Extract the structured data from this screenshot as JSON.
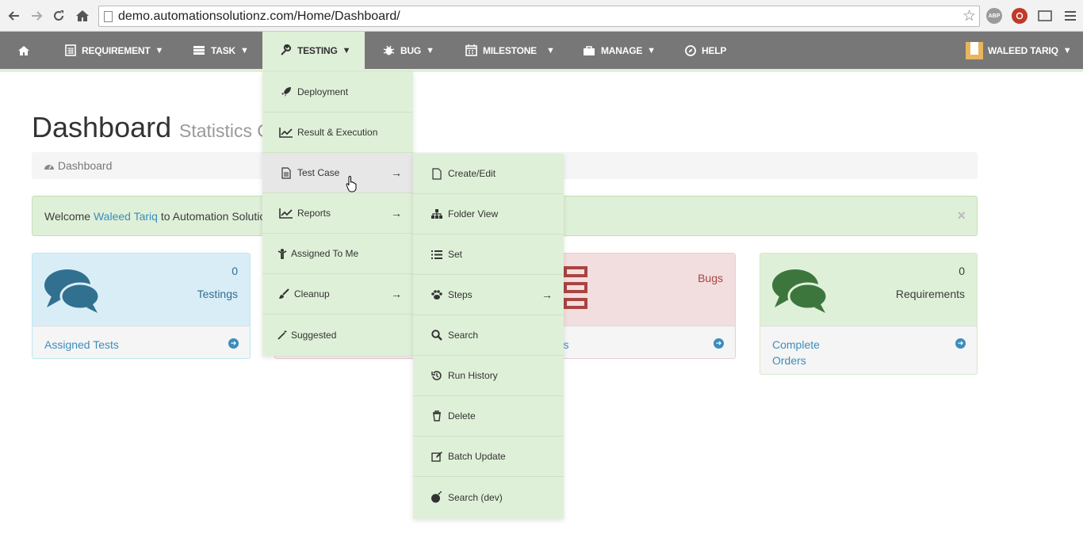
{
  "browser": {
    "url": "demo.automationsolutionz.com/Home/Dashboard/",
    "extensions": [
      "ABP"
    ]
  },
  "navbar": {
    "items": [
      {
        "label": "REQUIREMENT",
        "icon": "calculator-icon"
      },
      {
        "label": "TASK",
        "icon": "tasks-icon"
      },
      {
        "label": "TESTING",
        "icon": "wrench-icon",
        "active": true
      },
      {
        "label": "BUG",
        "icon": "bug-icon"
      },
      {
        "label": "MILESTONE",
        "icon": "calendar-icon"
      },
      {
        "label": "MANAGE",
        "icon": "briefcase-icon"
      },
      {
        "label": "HELP",
        "icon": "compass-icon"
      }
    ],
    "caret": "▼",
    "user": "WALEED TARIQ"
  },
  "page": {
    "title": "Dashboard",
    "subtitle": "Statistics Overview",
    "breadcrumb": "Dashboard"
  },
  "alert": {
    "prefix": "Welcome",
    "user": "Waleed Tariq",
    "suffix": "to Automation Solutionz",
    "close": "×"
  },
  "panels": [
    {
      "count": "0",
      "label": "Testings",
      "link": "Assigned Tests"
    },
    {
      "count": "",
      "label": "Bugs",
      "link": "Issues"
    },
    {
      "count": "0",
      "label": "Requirements",
      "link": "Complete Orders"
    }
  ],
  "testing_menu": {
    "items": [
      {
        "label": "Deployment",
        "icon": "rocket-icon"
      },
      {
        "label": "Result & Execution",
        "icon": "line-chart-icon"
      },
      {
        "label": "Test Case",
        "icon": "file-icon",
        "submenu": true
      },
      {
        "label": "Reports",
        "icon": "line-chart-icon",
        "submenu": true
      },
      {
        "label": "Assigned To Me",
        "icon": "child-icon"
      },
      {
        "label": "Cleanup",
        "icon": "paint-brush-icon",
        "submenu": true
      },
      {
        "label": "Suggested",
        "icon": "magic-icon"
      }
    ],
    "submenu_arrow": "→"
  },
  "testcase_menu": {
    "items": [
      {
        "label": "Create/Edit",
        "icon": "file-icon"
      },
      {
        "label": "Folder View",
        "icon": "sitemap-icon"
      },
      {
        "label": "Set",
        "icon": "list-icon"
      },
      {
        "label": "Steps",
        "icon": "paw-icon",
        "submenu": true
      },
      {
        "label": "Search",
        "icon": "search-icon"
      },
      {
        "label": "Run History",
        "icon": "history-icon"
      },
      {
        "label": "Delete",
        "icon": "trash-icon"
      },
      {
        "label": "Batch Update",
        "icon": "edit-icon"
      },
      {
        "label": "Search (dev)",
        "icon": "bomb-icon"
      }
    ]
  },
  "colors": {
    "navbar": "#777777",
    "menu_bg": "#dff0d8",
    "link": "#3c8dbc",
    "panel_blue": "#d9edf7",
    "panel_red": "#f2dede",
    "panel_green": "#dff0d8"
  }
}
